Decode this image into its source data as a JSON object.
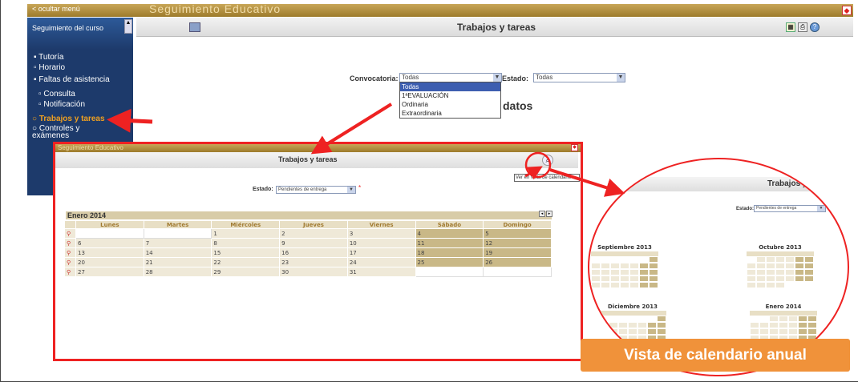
{
  "app": {
    "title": "Seguimiento Educativo",
    "hide_menu": "< ocultar menú"
  },
  "sidebar": {
    "header": "Seguimiento del curso",
    "items": [
      {
        "label": "Tutoría"
      },
      {
        "label": "Horario"
      },
      {
        "label": "Faltas de asistencia"
      },
      {
        "label": "Consulta"
      },
      {
        "label": "Notificación"
      },
      {
        "label": "Trabajos y tareas"
      },
      {
        "label": "Controles y exámenes"
      }
    ]
  },
  "main": {
    "title": "Trabajos y tareas",
    "convocatoria_label": "Convocatoria:",
    "convocatoria_value": "Todas",
    "estado_label": "Estado:",
    "estado_value": "Todas",
    "dropdown_options": [
      "Todas",
      "1ªEVALUACIÓN",
      "Ordinaria",
      "Extraordinaria"
    ],
    "no_data_fragment": "datos"
  },
  "inner": {
    "title_bar": "Seguimiento Educativo",
    "title": "Trabajos y tareas",
    "estado_label": "Estado:",
    "estado_value": "Pendientes de entrega",
    "tooltip": "Ver en vista de calendario",
    "calendar": {
      "month": "Enero 2014",
      "days": [
        "Lunes",
        "Martes",
        "Miércoles",
        "Jueves",
        "Viernes",
        "Sábado",
        "Domingo"
      ],
      "weeks": [
        [
          "",
          "",
          "1",
          "2",
          "3",
          "4",
          "5"
        ],
        [
          "6",
          "7",
          "8",
          "9",
          "10",
          "11",
          "12"
        ],
        [
          "13",
          "14",
          "15",
          "16",
          "17",
          "18",
          "19"
        ],
        [
          "20",
          "21",
          "22",
          "23",
          "24",
          "25",
          "26"
        ],
        [
          "27",
          "28",
          "29",
          "30",
          "31",
          "",
          ""
        ]
      ]
    }
  },
  "zoom": {
    "title": "Trabajos y",
    "estado_label": "Estado:",
    "estado_value": "Pendientes de entrega",
    "months": [
      {
        "name": "Septiembre 2013"
      },
      {
        "name": "Octubre 2013"
      },
      {
        "name": "Diciembre 2013"
      },
      {
        "name": "Enero 2014"
      }
    ]
  },
  "badge": {
    "text": "Vista de calendario anual"
  },
  "colors": {
    "accent_red": "#e22222",
    "badge_orange": "#f0923a",
    "sidebar_blue": "#1d3a6b",
    "gold": "#c8a658"
  }
}
